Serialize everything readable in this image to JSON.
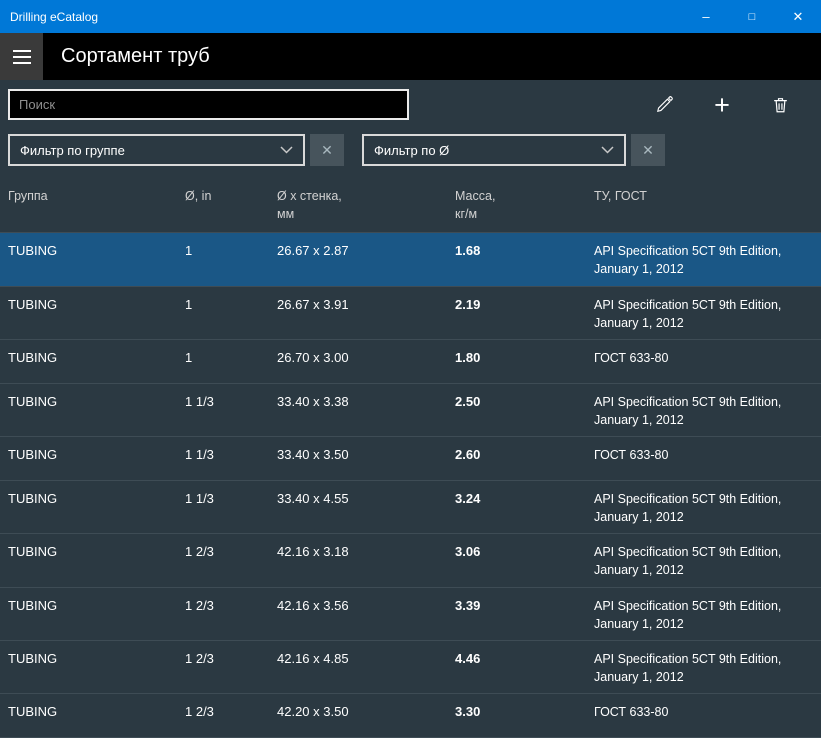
{
  "window": {
    "title": "Drilling eCatalog",
    "minimize": "–",
    "maximize": "□",
    "close": "✕"
  },
  "header": {
    "title": "Сортамент труб"
  },
  "search": {
    "placeholder": "Поиск",
    "value": ""
  },
  "toolbar": {
    "edit_icon": "pencil-icon",
    "add_icon": "plus-icon",
    "add_glyph": "+",
    "delete_icon": "trash-icon"
  },
  "filters": {
    "group": {
      "value": "Фильтр по группе",
      "clear_glyph": "✕"
    },
    "diameter": {
      "value": "Фильтр по Ø",
      "clear_glyph": "✕"
    }
  },
  "table": {
    "columns": [
      "Группа",
      "Ø, in",
      "Ø x стенка,\nмм",
      "Масса,\nкг/м",
      "ТУ,  ГОСТ"
    ],
    "rows": [
      {
        "group": "TUBING",
        "diameter": "1",
        "size": "26.67 x 2.87",
        "mass": "1.68",
        "standard": "API Specification 5CT 9th Edition, January 1, 2012",
        "selected": true
      },
      {
        "group": "TUBING",
        "diameter": "1",
        "size": "26.67 x 3.91",
        "mass": "2.19",
        "standard": "API Specification 5CT 9th Edition, January 1, 2012",
        "selected": false
      },
      {
        "group": "TUBING",
        "diameter": "1",
        "size": "26.70 x 3.00",
        "mass": "1.80",
        "standard": "ГОСТ 633-80",
        "selected": false
      },
      {
        "group": "TUBING",
        "diameter": "1 1/3",
        "size": "33.40 x 3.38",
        "mass": "2.50",
        "standard": "API Specification 5CT 9th Edition, January 1, 2012",
        "selected": false
      },
      {
        "group": "TUBING",
        "diameter": "1 1/3",
        "size": "33.40 x 3.50",
        "mass": "2.60",
        "standard": "ГОСТ 633-80",
        "selected": false
      },
      {
        "group": "TUBING",
        "diameter": "1 1/3",
        "size": "33.40 x 4.55",
        "mass": "3.24",
        "standard": "API Specification 5CT 9th Edition, January 1, 2012",
        "selected": false
      },
      {
        "group": "TUBING",
        "diameter": "1 2/3",
        "size": "42.16 x 3.18",
        "mass": "3.06",
        "standard": "API Specification 5CT 9th Edition, January 1, 2012",
        "selected": false
      },
      {
        "group": "TUBING",
        "diameter": "1 2/3",
        "size": "42.16 x 3.56",
        "mass": "3.39",
        "standard": "API Specification 5CT 9th Edition, January 1, 2012",
        "selected": false
      },
      {
        "group": "TUBING",
        "diameter": "1 2/3",
        "size": "42.16 x 4.85",
        "mass": "4.46",
        "standard": "API Specification 5CT 9th Edition, January 1, 2012",
        "selected": false
      },
      {
        "group": "TUBING",
        "diameter": "1 2/3",
        "size": "42.20 x 3.50",
        "mass": "3.30",
        "standard": "ГОСТ 633-80",
        "selected": false
      }
    ]
  }
}
